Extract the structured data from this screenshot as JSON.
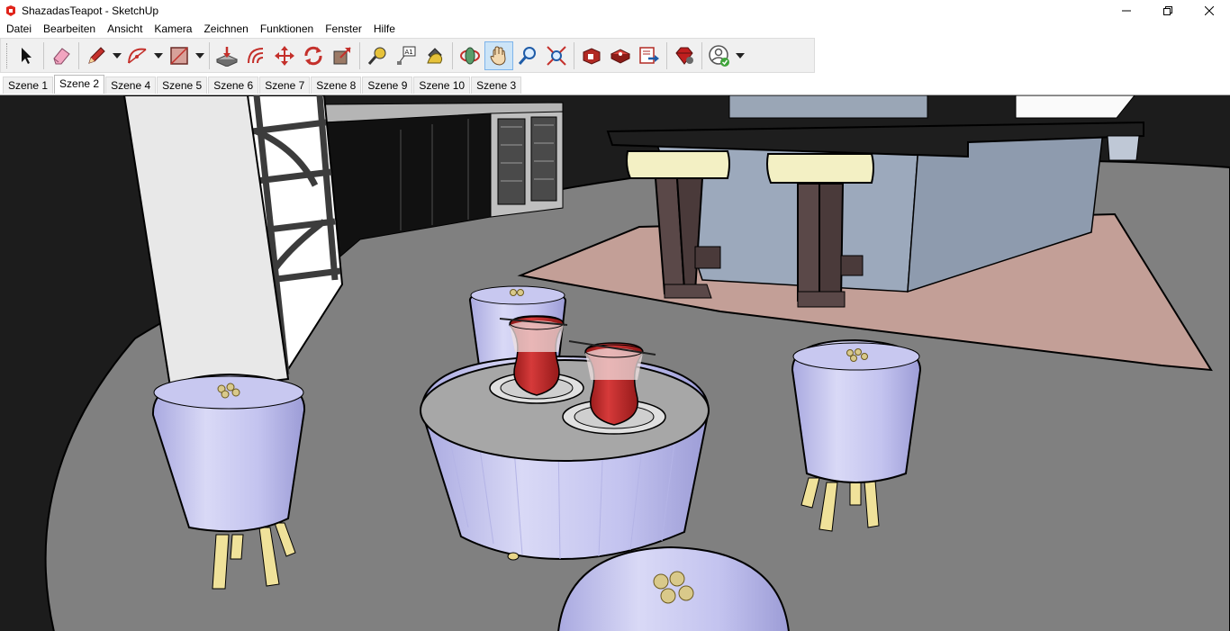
{
  "window": {
    "title": "ShazadasTeapot - SketchUp",
    "app_icon": "sketchup-logo-icon",
    "controls": [
      "minimize-icon",
      "restore-icon",
      "close-icon"
    ]
  },
  "menu": {
    "items": [
      "Datei",
      "Bearbeiten",
      "Ansicht",
      "Kamera",
      "Zeichnen",
      "Funktionen",
      "Fenster",
      "Hilfe"
    ]
  },
  "toolbar": {
    "tools": [
      {
        "icon": "select-arrow-icon",
        "active": false
      },
      {
        "icon": "eraser-icon",
        "active": false
      },
      {
        "icon": "pencil-line-icon",
        "active": false,
        "dropdown": true
      },
      {
        "icon": "arc-icon",
        "active": false,
        "dropdown": true
      },
      {
        "icon": "rectangle-icon",
        "active": false,
        "dropdown": true
      },
      {
        "icon": "push-pull-icon",
        "active": false
      },
      {
        "icon": "offset-icon",
        "active": false
      },
      {
        "icon": "move-icon",
        "active": false
      },
      {
        "icon": "rotate-icon",
        "active": false
      },
      {
        "icon": "scale-icon",
        "active": false
      },
      {
        "icon": "tape-measure-icon",
        "active": false
      },
      {
        "icon": "text-label-icon",
        "active": false
      },
      {
        "icon": "paint-bucket-icon",
        "active": false
      },
      {
        "icon": "orbit-icon",
        "active": false
      },
      {
        "icon": "pan-hand-icon",
        "active": true
      },
      {
        "icon": "zoom-icon",
        "active": false
      },
      {
        "icon": "zoom-extents-icon",
        "active": false
      },
      {
        "icon": "3d-warehouse-icon",
        "active": false
      },
      {
        "icon": "extension-warehouse-icon",
        "active": false
      },
      {
        "icon": "send-to-layout-icon",
        "active": false
      },
      {
        "icon": "extension-manager-ruby-icon",
        "active": false
      },
      {
        "icon": "account-user-icon",
        "active": false,
        "dropdown": true
      }
    ],
    "accent": "#cce4f7"
  },
  "scenes": {
    "tabs": [
      "Szene 1",
      "Szene 2",
      "Szene 4",
      "Szene 5",
      "Szene 6",
      "Szene 7",
      "Szene 8",
      "Szene 9",
      "Szene 10",
      "Szene 3"
    ],
    "active_index": 1
  },
  "viewport": {
    "background": "#1a1a1a",
    "floor_color": "#808080",
    "rug_color": "#c9a39b",
    "stool_color": "#c8c8f0",
    "tea_color": "#c0282a"
  }
}
